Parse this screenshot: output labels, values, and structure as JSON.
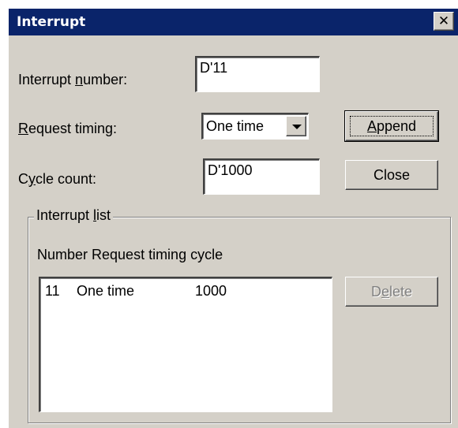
{
  "window": {
    "title": "Interrupt",
    "close_glyph": "✕"
  },
  "form": {
    "interrupt_number": {
      "label_pre": "Interrupt ",
      "label_accel": "n",
      "label_post": "umber:",
      "value": "D'11"
    },
    "request_timing": {
      "label_pre": "",
      "label_accel": "R",
      "label_post": "equest timing:",
      "selected": "One time"
    },
    "cycle_count": {
      "label_pre": "C",
      "label_accel": "y",
      "label_post": "cle count:",
      "value": "D'1000"
    }
  },
  "buttons": {
    "append": {
      "pre": "",
      "accel": "A",
      "post": "ppend"
    },
    "close": {
      "label": "Close"
    },
    "delete": {
      "pre": "D",
      "accel": "e",
      "post": "lete"
    }
  },
  "interrupt_list": {
    "group_pre": "Interrupt ",
    "group_accel": "l",
    "group_post": "ist",
    "header": "Number  Request timing cycle",
    "rows": [
      {
        "number": "11",
        "timing": "One time",
        "cycle": "1000"
      }
    ]
  }
}
